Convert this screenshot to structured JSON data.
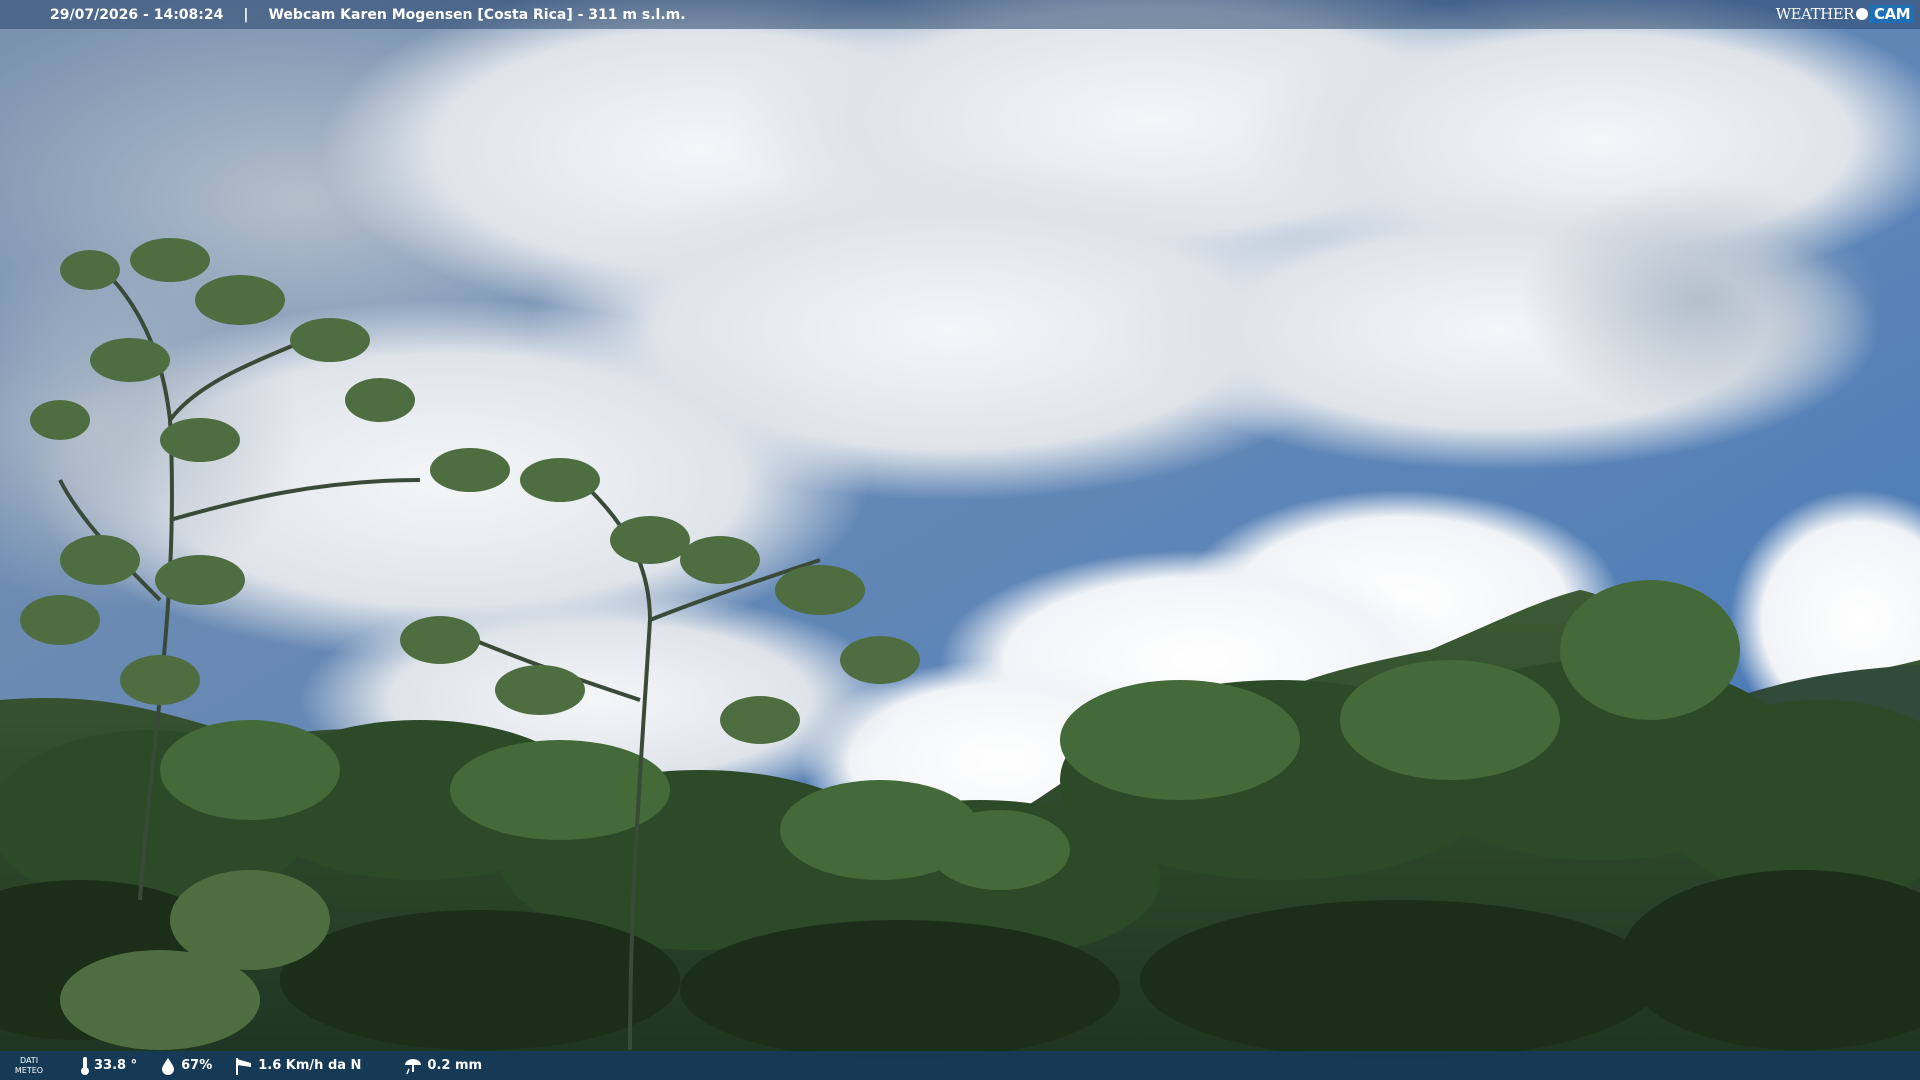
{
  "header": {
    "timestamp": "29/07/2026 - 14:08:24",
    "separator": "|",
    "title": "Webcam Karen Mogensen [Costa Rica]  - 311 m s.l.m."
  },
  "logo": {
    "weather": "WEATHER",
    "cam": "CAM"
  },
  "footer": {
    "label_line1": "DATI",
    "label_line2": "METEO",
    "temperature": "33.8 °",
    "humidity": "67%",
    "wind": "1.6 Km/h da N",
    "rain": "0.2 mm"
  },
  "icons": [
    "thermometer-icon",
    "humidity-drop-icon",
    "wind-windsock-icon",
    "rain-gauge-icon"
  ],
  "colors": {
    "sky": "#5b84b8",
    "cloud": "#eef1f5",
    "forest": "#2e4a2a",
    "bar": "#143c64"
  }
}
